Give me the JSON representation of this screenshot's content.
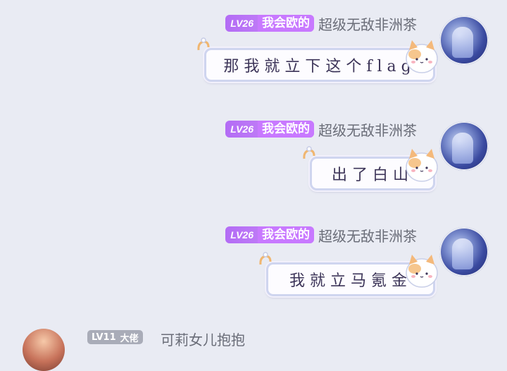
{
  "messages": [
    {
      "level": "LV26",
      "title": "我会欧的",
      "username": "超级无敌非洲茶",
      "text": "那我就立下这个flag"
    },
    {
      "level": "LV26",
      "title": "我会欧的",
      "username": "超级无敌非洲茶",
      "text": "出了白山"
    },
    {
      "level": "LV26",
      "title": "我会欧的",
      "username": "超级无敌非洲茶",
      "text": "我就立马氪金"
    }
  ],
  "partial_message": {
    "level": "LV11",
    "title": "大佬",
    "username": "可莉女儿抱抱"
  },
  "colors": {
    "background": "#e9ebf3",
    "badge_purple": "#c879ff",
    "bubble_border": "#cfd5ef",
    "text_dark": "#3c3458"
  }
}
